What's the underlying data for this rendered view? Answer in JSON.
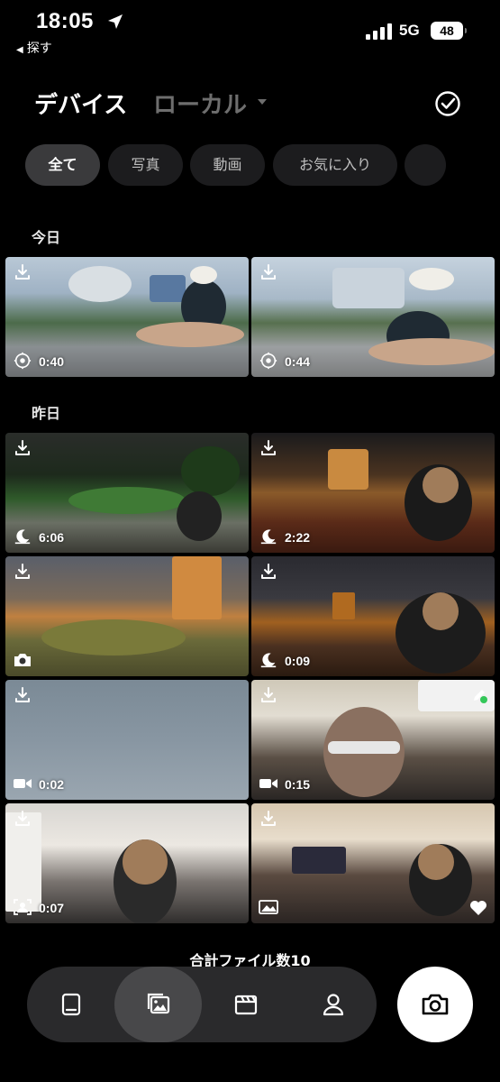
{
  "status_bar": {
    "time": "18:05",
    "back_app_label": "探す",
    "network": "5G",
    "battery": "48"
  },
  "header": {
    "tab_device": "デバイス",
    "tab_local": "ローカル"
  },
  "filters": [
    {
      "label": "全て",
      "active": true
    },
    {
      "label": "写真",
      "active": false
    },
    {
      "label": "動画",
      "active": false
    },
    {
      "label": "お気に入り",
      "active": false
    },
    {
      "label": "",
      "active": false
    }
  ],
  "sections": [
    {
      "title": "今日",
      "items": [
        {
          "type": "360-video",
          "duration": "0:40"
        },
        {
          "type": "360-video",
          "duration": "0:44"
        }
      ]
    },
    {
      "title": "昨日",
      "items": [
        {
          "type": "night-video",
          "duration": "6:06"
        },
        {
          "type": "night-video",
          "duration": "2:22"
        },
        {
          "type": "photo",
          "duration": ""
        },
        {
          "type": "night-video",
          "duration": "0:09"
        },
        {
          "type": "video",
          "duration": "0:02"
        },
        {
          "type": "video",
          "duration": "0:15",
          "edited": true
        },
        {
          "type": "portrait-video",
          "duration": "0:07"
        },
        {
          "type": "panorama-photo",
          "duration": "",
          "favorite": true
        }
      ]
    }
  ],
  "footer": {
    "total_files": "合計ファイル数10"
  },
  "nav": {
    "items": [
      "home-icon",
      "gallery-icon",
      "clapper-icon",
      "profile-icon"
    ],
    "active": "gallery-icon"
  },
  "colors": {
    "background": "#000000",
    "chip_active": "#3a3a3c",
    "chip": "#1c1c1e",
    "nav_bg": "#2a2a2c",
    "edit_badge": "#34c759"
  }
}
